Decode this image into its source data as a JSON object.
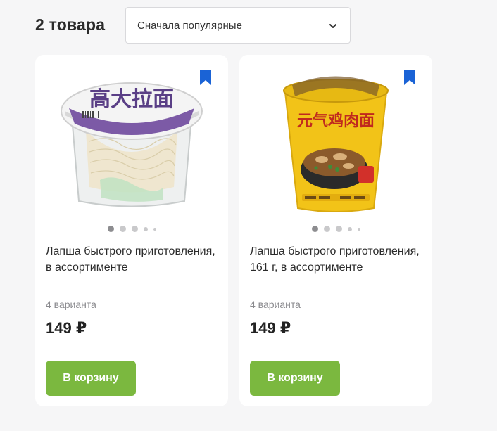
{
  "header": {
    "count_label": "2 товара",
    "sort": {
      "selected": "Сначала популярные",
      "icon": "chevron-down-icon"
    }
  },
  "products": [
    {
      "title": "Лапша быстрого приготовления, в ассортименте",
      "variants": "4 варианта",
      "price": "149 ₽",
      "button_label": "В корзину",
      "package_text": "高大拉面",
      "bookmark_icon": "bookmark-icon",
      "accent_color": "#7c5aa6"
    },
    {
      "title": "Лапша быстрого приготовления, 161 г, в ассортименте",
      "variants": "4 варианта",
      "price": "149 ₽",
      "button_label": "В корзину",
      "package_text": "元气鸡肉面",
      "bookmark_icon": "bookmark-icon",
      "accent_color": "#f2c318"
    }
  ],
  "colors": {
    "button": "#7bb83f",
    "bookmark": "#1a63d6",
    "background": "#f6f6f7"
  }
}
